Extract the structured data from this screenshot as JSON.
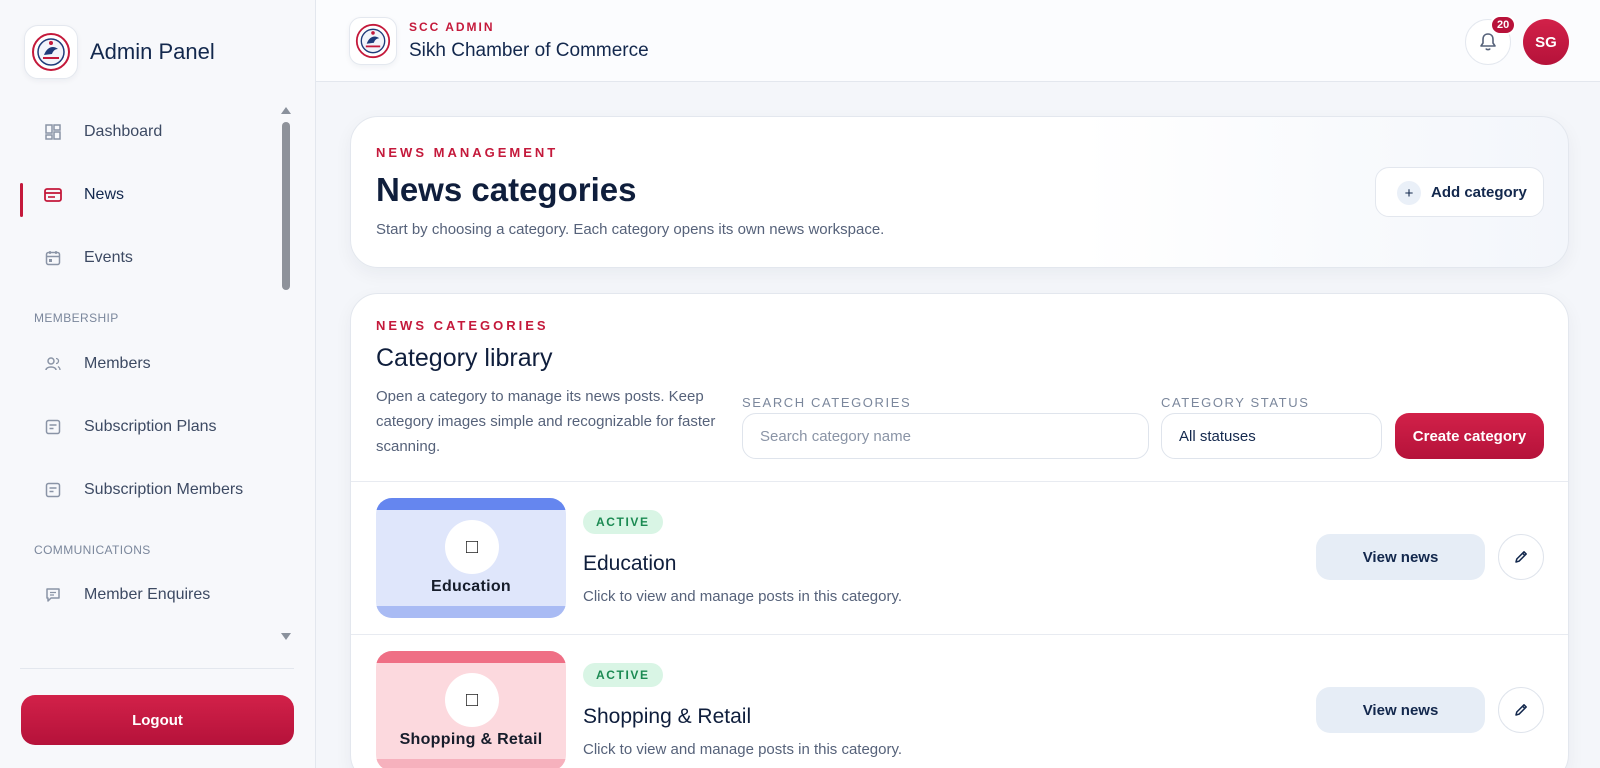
{
  "colors": {
    "accent": "#c4193b",
    "navy": "#13284d",
    "active_badge_bg": "#d9f5e5",
    "active_badge_text": "#1b8a52"
  },
  "sidebar": {
    "title": "Admin Panel",
    "items": [
      {
        "label": "Dashboard",
        "icon": "dashboard-icon"
      },
      {
        "label": "News",
        "icon": "news-icon",
        "active": true
      },
      {
        "label": "Events",
        "icon": "calendar-icon"
      },
      {
        "label": "Members",
        "icon": "users-icon"
      },
      {
        "label": "Subscription Plans",
        "icon": "document-icon"
      },
      {
        "label": "Subscription Members",
        "icon": "document-icon"
      },
      {
        "label": "Member Enquires",
        "icon": "chat-icon"
      }
    ],
    "sections": {
      "membership": "MEMBERSHIP",
      "communications": "COMMUNICATIONS"
    },
    "logout_label": "Logout"
  },
  "topbar": {
    "eyebrow": "SCC ADMIN",
    "title": "Sikh Chamber of Commerce",
    "notification_count": "20",
    "avatar_initials": "SG"
  },
  "hero": {
    "eyebrow": "NEWS MANAGEMENT",
    "title": "News categories",
    "subtitle": "Start by choosing a category. Each category opens its own news workspace.",
    "add_button": "Add category"
  },
  "library": {
    "eyebrow": "NEWS CATEGORIES",
    "title": "Category library",
    "description": "Open a category to manage its news posts. Keep category images simple and recognizable for faster scanning.",
    "search_label": "SEARCH CATEGORIES",
    "search_placeholder": "Search category name",
    "status_label": "CATEGORY STATUS",
    "status_value": "All statuses",
    "create_button": "Create category",
    "categories": [
      {
        "name": "Education",
        "thumb_label": "Education",
        "status": "ACTIVE",
        "description": "Click to view and manage posts in this category.",
        "view_label": "View news",
        "thumb_bg": "#dfe6fb",
        "thumb_bar_top": "#6586ef",
        "thumb_bar_bottom": "#a9bbf4"
      },
      {
        "name": "Shopping & Retail",
        "thumb_label": "Shopping & Retail",
        "status": "ACTIVE",
        "description": "Click to view and manage posts in this category.",
        "view_label": "View news",
        "thumb_bg": "#fcd9de",
        "thumb_bar_top": "#ef6f85",
        "thumb_bar_bottom": "#f6b1bd"
      }
    ]
  }
}
